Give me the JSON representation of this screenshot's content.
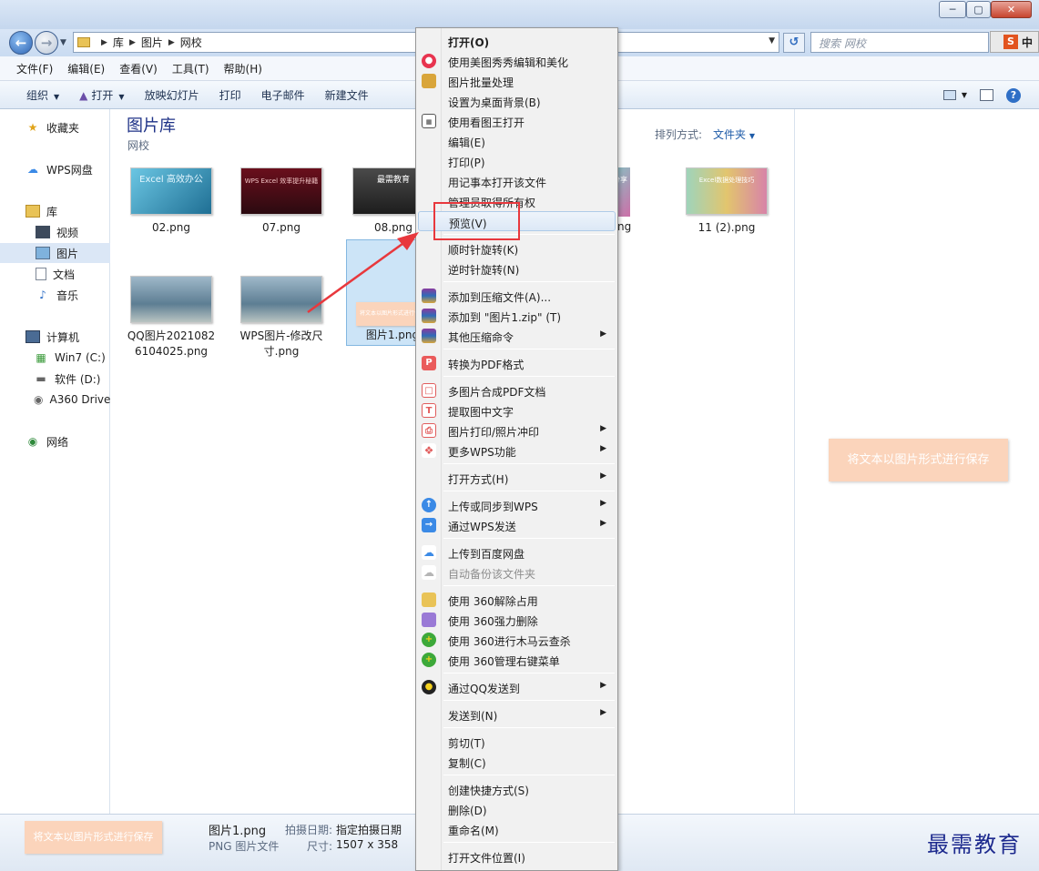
{
  "window": {
    "caption_buttons": [
      "─",
      "▢",
      "✕"
    ]
  },
  "nav": {
    "breadcrumb": [
      "库",
      "图片",
      "网校"
    ],
    "search_placeholder": "搜索 网校",
    "ime": {
      "s": "S",
      "lang": "中"
    }
  },
  "menubar": [
    "文件(F)",
    "编辑(E)",
    "查看(V)",
    "工具(T)",
    "帮助(H)"
  ],
  "toolbar": {
    "organize": "组织",
    "open": "打开",
    "slideshow": "放映幻灯片",
    "print": "打印",
    "email": "电子邮件",
    "new_folder": "新建文件"
  },
  "navpane": {
    "favorites": "收藏夹",
    "wps": "WPS网盘",
    "library": "库",
    "video": "视频",
    "pictures": "图片",
    "documents": "文档",
    "music": "音乐",
    "computer": "计算机",
    "drive_c": "Win7 (C:)",
    "drive_d": "软件 (D:)",
    "drive_a360": "A360 Drive",
    "network": "网络"
  },
  "content": {
    "title": "图片库",
    "subtitle": "网校",
    "sort_label": "排列方式:",
    "sort_value": "文件夹",
    "files": [
      {
        "name": "02.png"
      },
      {
        "name": "07.png"
      },
      {
        "name": "08.png"
      },
      {
        "name": "11 (2).png"
      },
      {
        "name": "QQ图片20210826104025.png"
      },
      {
        "name": "WPS图片-修改尺寸.png"
      },
      {
        "name": "图片1.png"
      }
    ],
    "partial_name": "ng",
    "thumb_text": {
      "excel": "Excel 高效办公",
      "wps": "WPS Excel 效率提升秘籍",
      "edu": "最需教育",
      "share": "分享",
      "card": "Excel数据处理技巧",
      "pic1": "将文本以图片形式进行保存"
    }
  },
  "preview": {
    "text": "将文本以图片形式进行保存"
  },
  "details": {
    "thumb_text": "将文本以图片形式进行保存",
    "filename": "图片1.png",
    "filetype": "PNG 图片文件",
    "date_label": "拍摄日期:",
    "date_value": "指定拍摄日期",
    "size_label": "尺寸:",
    "size_value": "1507 x 358"
  },
  "context_menu": {
    "open": "打开(O)",
    "meitu": "使用美图秀秀编辑和美化",
    "batch": "图片批量处理",
    "wallpaper": "设置为桌面背景(B)",
    "kantu": "使用看图王打开",
    "edit": "编辑(E)",
    "print": "打印(P)",
    "notepad": "用记事本打开该文件",
    "admin": "管理员取得所有权",
    "preview": "预览(V)",
    "rotate_cw": "顺时针旋转(K)",
    "rotate_ccw": "逆时针旋转(N)",
    "add_archive": "添加到压缩文件(A)...",
    "add_zip": "添加到 \"图片1.zip\" (T)",
    "other_compress": "其他压缩命令",
    "to_pdf": "转换为PDF格式",
    "multi_pdf": "多图片合成PDF文档",
    "ocr": "提取图中文字",
    "photo_print": "图片打印/照片冲印",
    "more_wps": "更多WPS功能",
    "open_with": "打开方式(H)",
    "upload_wps": "上传或同步到WPS",
    "send_wps": "通过WPS发送",
    "baidu": "上传到百度网盘",
    "auto_backup": "自动备份该文件夹",
    "unlock360": "使用 360解除占用",
    "force_delete360": "使用 360强力删除",
    "trojan360": "使用 360进行木马云查杀",
    "manage360": "使用 360管理右键菜单",
    "qq_send": "通过QQ发送到",
    "send_to": "发送到(N)",
    "cut": "剪切(T)",
    "copy": "复制(C)",
    "shortcut": "创建快捷方式(S)",
    "delete": "删除(D)",
    "rename": "重命名(M)",
    "open_location": "打开文件位置(I)"
  },
  "watermark": "最需教育",
  "colors": {
    "highlight_box": "#e8383d",
    "accent": "#1e5ba8"
  }
}
